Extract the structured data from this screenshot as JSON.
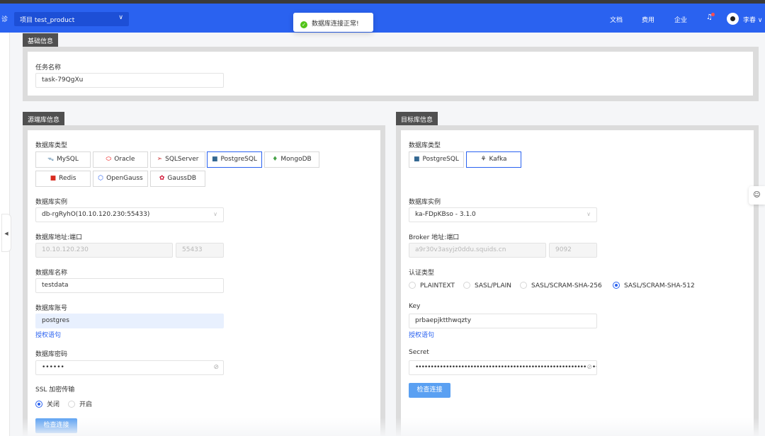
{
  "header": {
    "edge_glyph": "诊",
    "project_label": "项目 test_product",
    "nav": [
      "文档",
      "费用",
      "企业"
    ],
    "user_name": "李春",
    "user_chevron": "∨",
    "brand_color": "#2a62f0"
  },
  "toast": {
    "message": "数据库连接正常!"
  },
  "basic": {
    "section_title": "基础信息",
    "task_name_label": "任务名称",
    "task_name_value": "task-79QgXu"
  },
  "source": {
    "section_title": "源端库信息",
    "db_type_label": "数据库类型",
    "db_types": [
      {
        "label": "MySQL",
        "icon": "mysql-dolphin-icon",
        "selected": false
      },
      {
        "label": "Oracle",
        "icon": "oracle-icon",
        "selected": false
      },
      {
        "label": "SQLServer",
        "icon": "sqlserver-icon",
        "selected": false
      },
      {
        "label": "PostgreSQL",
        "icon": "postgresql-elephant-icon",
        "selected": true
      },
      {
        "label": "MongoDB",
        "icon": "mongodb-leaf-icon",
        "selected": false
      },
      {
        "label": "Redis",
        "icon": "redis-icon",
        "selected": false
      },
      {
        "label": "OpenGauss",
        "icon": "opengauss-icon",
        "selected": false
      },
      {
        "label": "GaussDB",
        "icon": "huawei-gaussdb-icon",
        "selected": false
      }
    ],
    "instance_label": "数据库实例",
    "instance_value": "db-rgRyhO(10.10.120.230:55433)",
    "address_label": "数据库地址:端口",
    "host_value": "10.10.120.230",
    "port_value": "55433",
    "dbname_label": "数据库名称",
    "dbname_value": "testdata",
    "account_label": "数据库账号",
    "account_value": "postgres",
    "grant_link": "授权语句",
    "password_label": "数据库密码",
    "password_mask": "••••••",
    "ssl_label": "SSL 加密传输",
    "ssl_options": [
      {
        "label": "关闭",
        "checked": true
      },
      {
        "label": "开启",
        "checked": false
      }
    ],
    "check_button": "检查连接"
  },
  "target": {
    "section_title": "目标库信息",
    "db_type_label": "数据库类型",
    "db_types": [
      {
        "label": "PostgreSQL",
        "icon": "postgresql-elephant-icon",
        "selected": false
      },
      {
        "label": "Kafka",
        "icon": "kafka-icon",
        "selected": true
      }
    ],
    "instance_label": "数据库实例",
    "instance_value": "ka-FDpKBso - 3.1.0",
    "broker_label": "Broker 地址:端口",
    "broker_host": "a9r30v3asyjz0ddu.squids.cn",
    "broker_port": "9092",
    "auth_label": "认证类型",
    "auth_options": [
      {
        "label": "PLAINTEXT",
        "checked": false
      },
      {
        "label": "SASL/PLAIN",
        "checked": false
      },
      {
        "label": "SASL/SCRAM-SHA-256",
        "checked": false
      },
      {
        "label": "SASL/SCRAM-SHA-512",
        "checked": true
      }
    ],
    "key_label": "Key",
    "key_value": "prbaepjktthwqzty",
    "grant_link": "授权语句",
    "secret_label": "Secret",
    "secret_mask": "••••••••••••••••••••••••••••••••••••••••••••••••••••••••••••",
    "check_button": "检查连接"
  }
}
